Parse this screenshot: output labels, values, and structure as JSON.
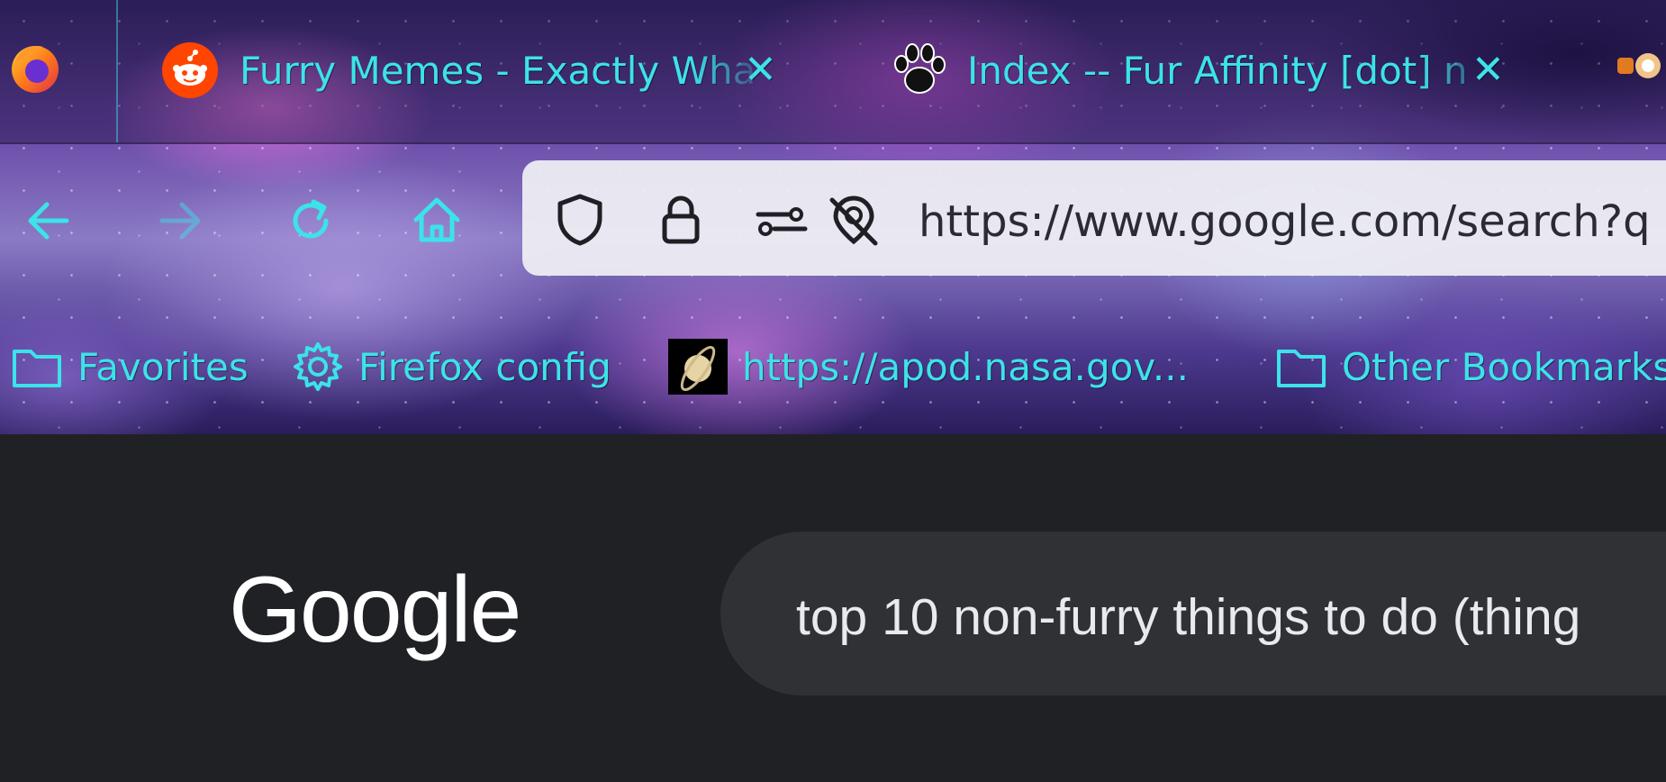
{
  "tabs": [
    {
      "title": "Furry Memes - Exactly Wha",
      "favicon": "reddit-icon"
    },
    {
      "title": "Index -- Fur Affinity [dot] n",
      "favicon": "paw-print-icon"
    }
  ],
  "tab_close_glyph": "✕",
  "navigation": {
    "back": "back-arrow-icon",
    "forward": "forward-arrow-icon",
    "reload": "reload-icon",
    "home": "home-icon"
  },
  "address_bar": {
    "url": "https://www.google.com/search?q",
    "icons": [
      "shield-icon",
      "lock-icon",
      "permissions-icon",
      "tracking-blocked-icon"
    ]
  },
  "bookmarks": [
    {
      "label": "Favorites",
      "icon": "folder-icon"
    },
    {
      "label": "Firefox config",
      "icon": "gear-icon"
    },
    {
      "label": "https://apod.nasa.gov...",
      "icon": "saturn-favicon"
    },
    {
      "label": "Other Bookmarks",
      "icon": "folder-icon"
    }
  ],
  "google": {
    "logo": "Google",
    "query": "top 10 non-furry things to do (thing"
  },
  "colors": {
    "chrome_accent": "#3ce3e8",
    "page_background": "#202124",
    "search_box": "#303134"
  }
}
